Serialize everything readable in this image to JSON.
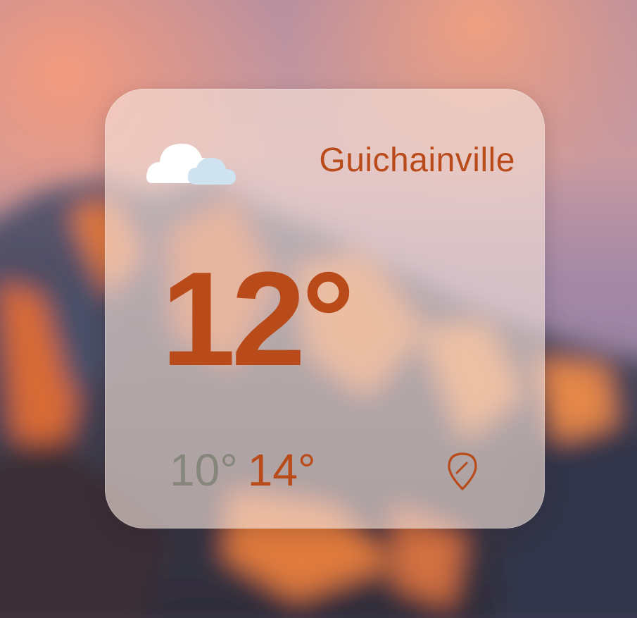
{
  "wallpaper": {
    "description_icon": "mountain-sunset-wallpaper"
  },
  "widget": {
    "city": "Guichainville",
    "condition_icon": "partly-cloudy-icon",
    "current_temp": "12°",
    "low_temp": "10°",
    "high_temp": "14°",
    "edit_location_icon": "location-edit-icon"
  },
  "colors": {
    "accent": "#b94a1a",
    "muted": "#86867c",
    "cloud_white": "#ffffff",
    "cloud_blue": "#cfe2f0"
  }
}
